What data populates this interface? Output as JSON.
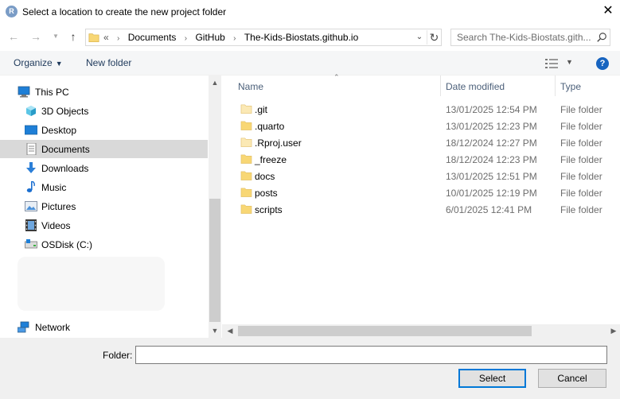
{
  "window": {
    "title": "Select a location to create the new project folder",
    "app_icon_letter": "R",
    "close_glyph": "✕"
  },
  "navigation": {
    "back_icon": "arrow-left-icon",
    "forward_icon": "arrow-right-icon",
    "up_icon": "arrow-up-icon",
    "breadcrumb_prefix": "«",
    "breadcrumbs": [
      "Documents",
      "GitHub",
      "The-Kids-Biostats.github.io"
    ],
    "search_placeholder": "Search The-Kids-Biostats.gith..."
  },
  "toolbar": {
    "organize_label": "Organize",
    "new_folder_label": "New folder",
    "help_label": "?"
  },
  "sidebar": {
    "items": [
      {
        "label": "This PC",
        "icon": "computer-icon"
      },
      {
        "label": "3D Objects",
        "icon": "cube-icon"
      },
      {
        "label": "Desktop",
        "icon": "desktop-icon"
      },
      {
        "label": "Documents",
        "icon": "documents-icon",
        "selected": true
      },
      {
        "label": "Downloads",
        "icon": "download-icon"
      },
      {
        "label": "Music",
        "icon": "music-note-icon"
      },
      {
        "label": "Pictures",
        "icon": "pictures-icon"
      },
      {
        "label": "Videos",
        "icon": "film-icon"
      },
      {
        "label": "OSDisk (C:)",
        "icon": "drive-icon"
      },
      {
        "label": "Network",
        "icon": "network-icon"
      }
    ]
  },
  "file_list": {
    "columns": [
      "Name",
      "Date modified",
      "Type"
    ],
    "rows": [
      {
        "name": ".git",
        "date": "13/01/2025 12:54 PM",
        "type": "File folder",
        "hidden": true
      },
      {
        "name": ".quarto",
        "date": "13/01/2025 12:23 PM",
        "type": "File folder",
        "hidden": false
      },
      {
        "name": ".Rproj.user",
        "date": "18/12/2024 12:27 PM",
        "type": "File folder",
        "hidden": true
      },
      {
        "name": "_freeze",
        "date": "18/12/2024 12:23 PM",
        "type": "File folder",
        "hidden": false
      },
      {
        "name": "docs",
        "date": "13/01/2025 12:51 PM",
        "type": "File folder",
        "hidden": false
      },
      {
        "name": "posts",
        "date": "10/01/2025 12:19 PM",
        "type": "File folder",
        "hidden": false
      },
      {
        "name": "scripts",
        "date": "6/01/2025 12:41 PM",
        "type": "File folder",
        "hidden": false
      }
    ]
  },
  "footer": {
    "folder_label": "Folder:",
    "folder_value": "",
    "select_label": "Select",
    "cancel_label": "Cancel"
  },
  "colors": {
    "accent": "#0078d7",
    "folder": "#f8d775",
    "folder_hidden": "#fbe9b5",
    "selection": "#d9d9d9"
  }
}
